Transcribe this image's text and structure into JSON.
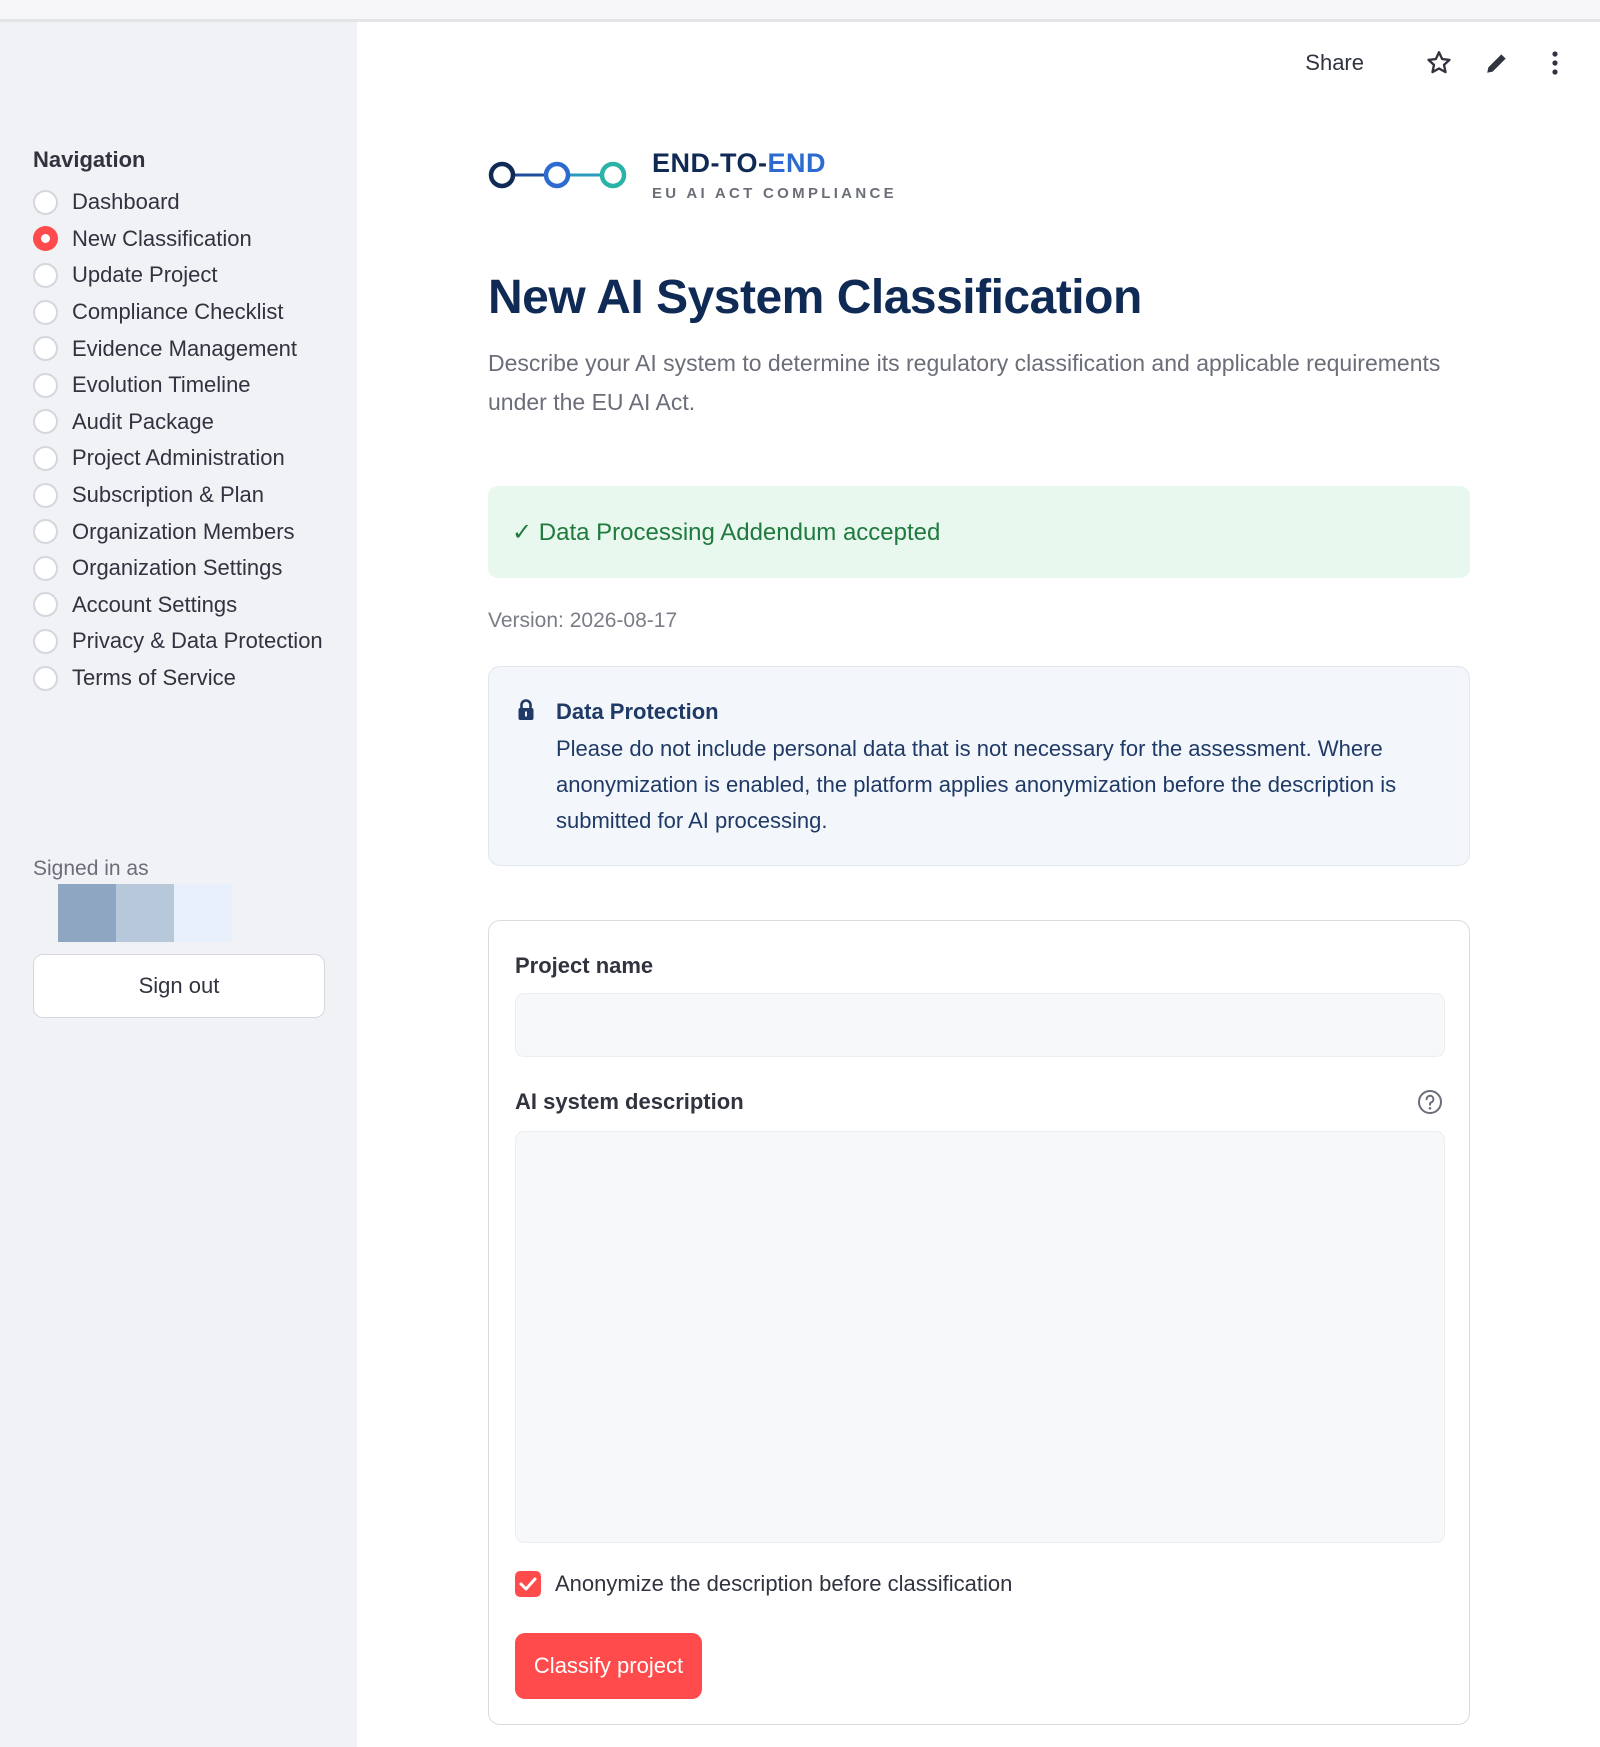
{
  "toolbar": {
    "share_label": "Share",
    "icons": [
      "star-icon",
      "pencil-icon",
      "more-vertical-icon"
    ]
  },
  "sidebar": {
    "title": "Navigation",
    "items": [
      {
        "label": "Dashboard",
        "selected": false
      },
      {
        "label": "New Classification",
        "selected": true
      },
      {
        "label": "Update Project",
        "selected": false
      },
      {
        "label": "Compliance Checklist",
        "selected": false
      },
      {
        "label": "Evidence Management",
        "selected": false
      },
      {
        "label": "Evolution Timeline",
        "selected": false
      },
      {
        "label": "Audit Package",
        "selected": false
      },
      {
        "label": "Project Administration",
        "selected": false
      },
      {
        "label": "Subscription & Plan",
        "selected": false
      },
      {
        "label": "Organization Members",
        "selected": false
      },
      {
        "label": "Organization Settings",
        "selected": false
      },
      {
        "label": "Account Settings",
        "selected": false
      },
      {
        "label": "Privacy & Data Protection",
        "selected": false
      },
      {
        "label": "Terms of Service",
        "selected": false
      }
    ],
    "signed_in_label": "Signed in as",
    "signout_label": "Sign out"
  },
  "logo": {
    "title_main": "END-TO-",
    "title_accent": "END",
    "subtitle": "EU AI ACT COMPLIANCE"
  },
  "header": {
    "title": "New AI System Classification",
    "description": "Describe your AI system to determine its regulatory classification and applicable requirements under the EU AI Act."
  },
  "dpa": {
    "message": "✓ Data Processing Addendum accepted",
    "version": "Version: 2026-08-17"
  },
  "info": {
    "title": "Data Protection",
    "text": "Please do not include personal data that is not necessary for the assessment. Where anonymization is enabled, the platform applies anonymization before the description is submitted for AI processing."
  },
  "form": {
    "project_name_label": "Project name",
    "project_name_value": "",
    "description_label": "AI system description",
    "description_value": "",
    "anonymize_label": "Anonymize the description before classification",
    "anonymize_checked": true,
    "submit_label": "Classify project"
  },
  "colors": {
    "accent": "#ff4b4b",
    "brand_dark": "#0f2a55",
    "brand_blue": "#2e6bd1",
    "brand_teal": "#2ab3a6",
    "success_bg": "#e9f8ee",
    "success_text": "#1f7a3e"
  }
}
